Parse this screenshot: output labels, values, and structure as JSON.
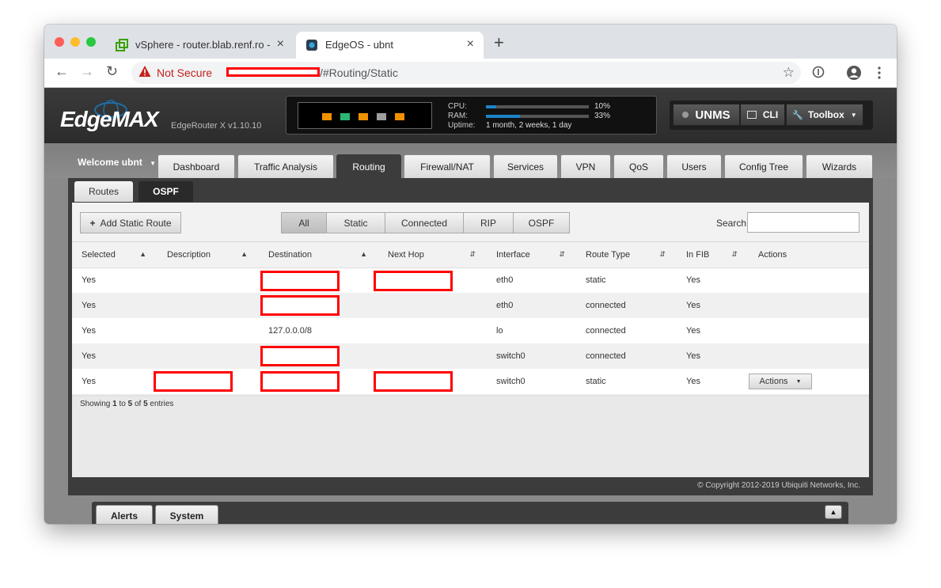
{
  "browser": {
    "tabs": [
      {
        "title": "vSphere - router.blab.renf.ro -",
        "close": "×"
      },
      {
        "title": "EdgeOS - ubnt",
        "close": "×"
      }
    ],
    "new_tab": "+",
    "not_secure": "Not Secure",
    "url_path": "/#Routing/Static"
  },
  "header": {
    "logo": "EdgeMAX",
    "model": "EdgeRouter X v1.10.10",
    "cpu_label": "CPU:",
    "cpu_value": "10%",
    "cpu_fraction": 0.1,
    "ram_label": "RAM:",
    "ram_value": "33%",
    "ram_fraction": 0.33,
    "uptime_label": "Uptime:",
    "uptime_value": "1 month, 2 weeks, 1 day",
    "port_colors": [
      "#f29100",
      "#2bb673",
      "#f29100",
      "#9e9e9e",
      "#f29100"
    ],
    "unms": "UNMS",
    "cli": "CLI",
    "toolbox": "Toolbox"
  },
  "nav": {
    "welcome": "Welcome ubnt",
    "tabs": [
      "Dashboard",
      "Traffic Analysis",
      "Routing",
      "Firewall/NAT",
      "Services",
      "VPN",
      "QoS",
      "Users",
      "Config Tree",
      "Wizards"
    ],
    "active": "Routing"
  },
  "subtabs": [
    "Routes",
    "OSPF"
  ],
  "controls": {
    "add_route": "Add Static Route",
    "filters": [
      "All",
      "Static",
      "Connected",
      "RIP",
      "OSPF"
    ],
    "search_label": "Search"
  },
  "table": {
    "columns": [
      "Selected",
      "Description",
      "Destination",
      "Next Hop",
      "Interface",
      "Route Type",
      "In FIB",
      "Actions"
    ],
    "rows": [
      {
        "selected": "Yes",
        "description": "",
        "destination": "",
        "next_hop": "",
        "interface": "eth0",
        "route_type": "static",
        "in_fib": "Yes"
      },
      {
        "selected": "Yes",
        "description": "",
        "destination": "",
        "next_hop": "",
        "interface": "eth0",
        "route_type": "connected",
        "in_fib": "Yes"
      },
      {
        "selected": "Yes",
        "description": "",
        "destination": "127.0.0.0/8",
        "next_hop": "",
        "interface": "lo",
        "route_type": "connected",
        "in_fib": "Yes"
      },
      {
        "selected": "Yes",
        "description": "",
        "destination": "",
        "next_hop": "",
        "interface": "switch0",
        "route_type": "connected",
        "in_fib": "Yes"
      },
      {
        "selected": "Yes",
        "description": "",
        "destination": "",
        "next_hop": "",
        "interface": "switch0",
        "route_type": "static",
        "in_fib": "Yes"
      }
    ],
    "actions_button": "Actions",
    "info_prefix": "Showing",
    "info_start": "1",
    "info_to": "to",
    "info_end": "5",
    "info_of": "of",
    "info_total": "5",
    "info_suffix": "entries"
  },
  "footer": "© Copyright 2012-2019 Ubiquiti Networks, Inc.",
  "bottom_tabs": [
    "Alerts",
    "System"
  ]
}
